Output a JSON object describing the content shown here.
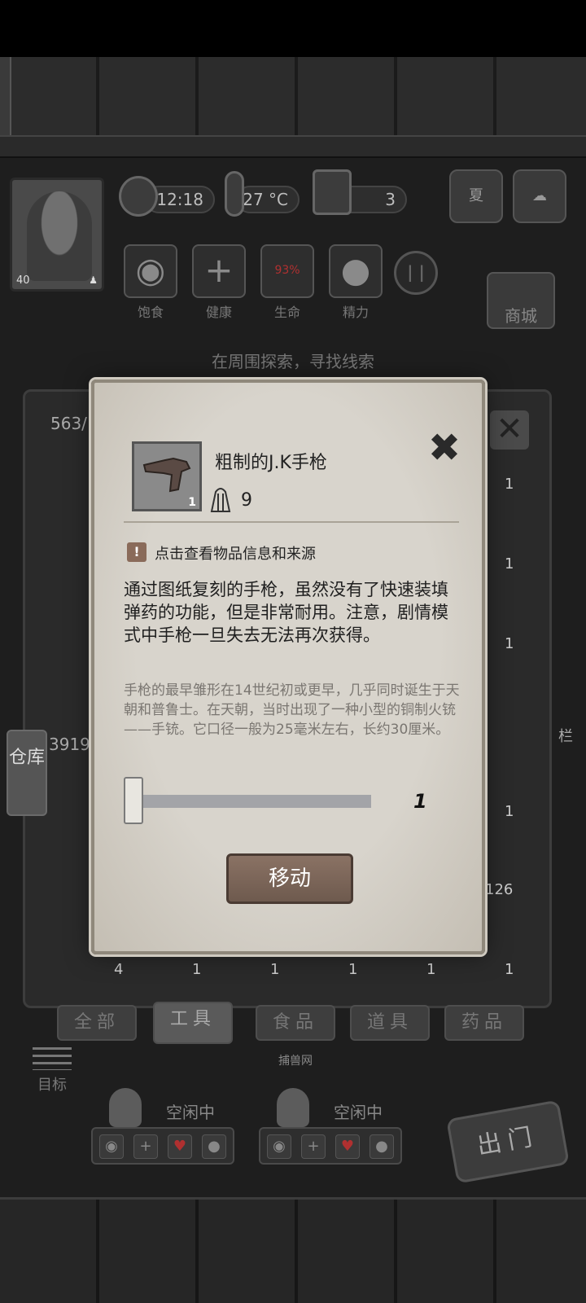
{
  "hud": {
    "time": "12:18",
    "temperature": "27 °C",
    "day": "3",
    "season": "夏",
    "level": "40",
    "health_percent": "93%"
  },
  "vitals": [
    "饱食",
    "健康",
    "生命",
    "精力"
  ],
  "shop_label": "商城",
  "hint": "在周围探索，寻找线索",
  "inventory": {
    "top_count": "563/",
    "bottom_count": "3919",
    "side_tab": "仓库",
    "right_edge_label": "栏",
    "cell_counts": [
      "1",
      "1",
      "1",
      "1",
      "126",
      "1",
      "4",
      "1",
      "1",
      "1",
      "1"
    ]
  },
  "category_tabs": [
    "全部",
    "工具",
    "食品",
    "道具",
    "药品"
  ],
  "tab_extra": "捕兽网",
  "target_label": "目标",
  "survivors": [
    {
      "status": "空闲中"
    },
    {
      "status": "空闲中"
    }
  ],
  "go_out_label": "出门",
  "dialog": {
    "item_name": "粗制的J.K手枪",
    "item_quantity": "1",
    "weight": "9",
    "info_link": "点击查看物品信息和来源",
    "description": "通过图纸复刻的手枪，虽然没有了快速装填弹药的功能，但是非常耐用。注意，剧情模式中手枪一旦失去无法再次获得。",
    "lore": "手枪的最早雏形在14世纪初或更早，几乎同时诞生于天朝和普鲁士。在天朝，当时出现了一种小型的铜制火铳——手铳。它口径一般为25毫米左右，长约30厘米。",
    "amount": "1",
    "move_label": "移动"
  }
}
